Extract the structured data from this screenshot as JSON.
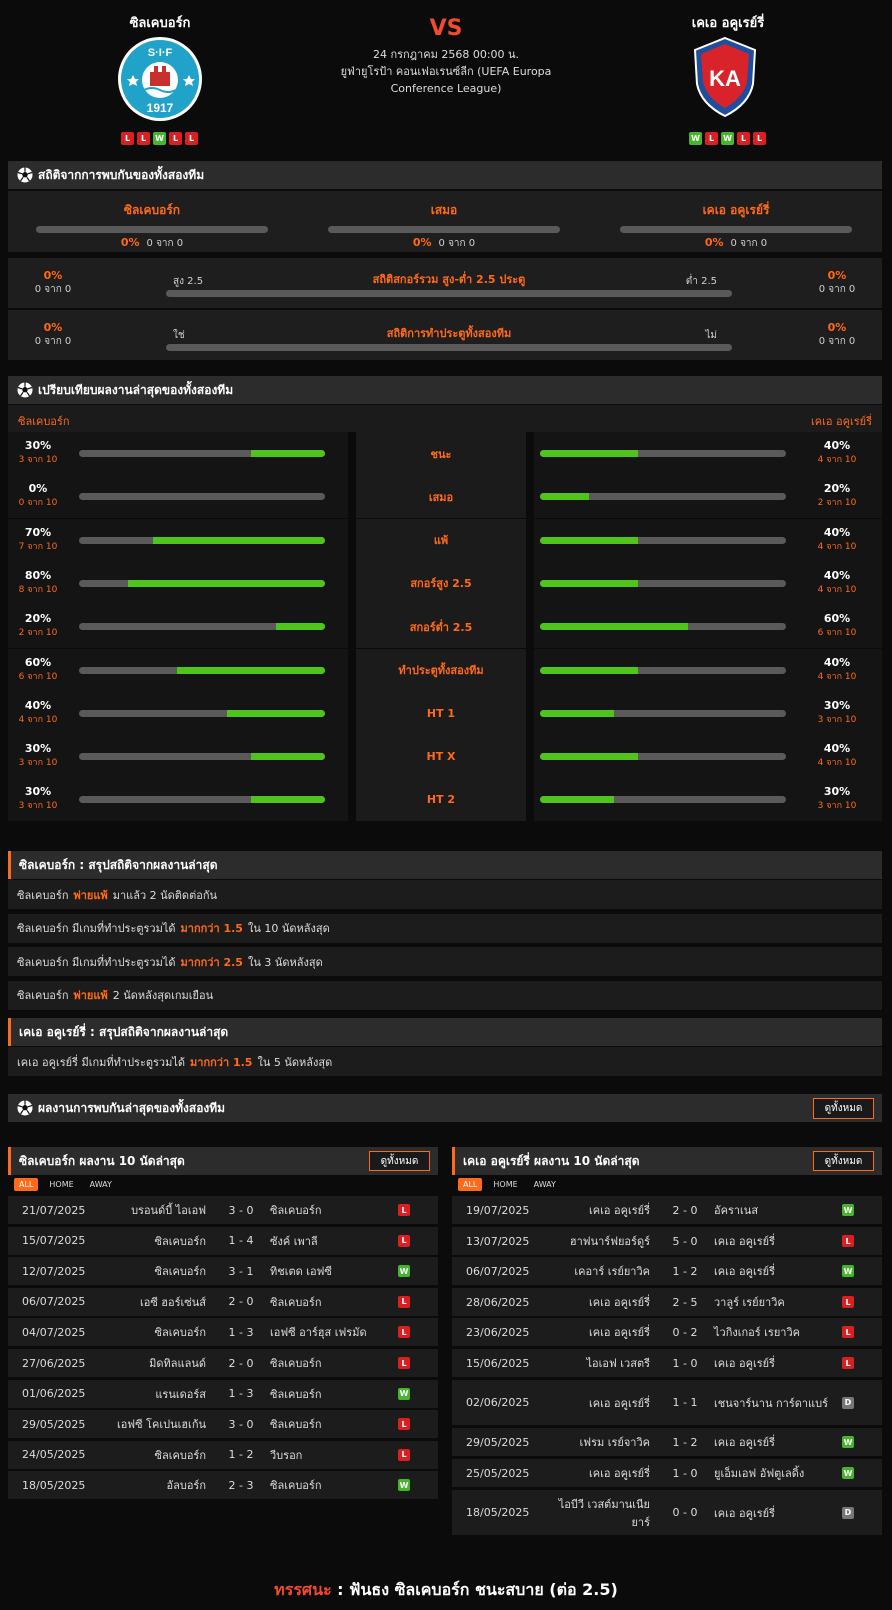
{
  "header": {
    "home": "ซิลเคบอร์ก",
    "away": "เคเอ อคูเรย์รี่",
    "vs": "VS",
    "date": "24 กรกฎาคม 2568 00:00 น.",
    "competition": "ยูฟ่ายูโรป้า คอนเฟอเรนซ์ลีก (UEFA Europa Conference League)",
    "home_form": [
      "L",
      "L",
      "W",
      "L",
      "L"
    ],
    "away_form": [
      "W",
      "L",
      "W",
      "L",
      "L"
    ],
    "home_logo_text": "S·I·F 1917",
    "away_logo_text": "KA"
  },
  "h2h": {
    "title": "สถิติจากการพบกันของทั้งสองทีม",
    "cols": [
      {
        "label": "ซิลเคบอร์ก",
        "pct": "0%",
        "of": "0 จาก 0"
      },
      {
        "label": "เสมอ",
        "pct": "0%",
        "of": "0 จาก 0"
      },
      {
        "label": "เคเอ อคูเรย์รี่",
        "pct": "0%",
        "of": "0 จาก 0"
      }
    ],
    "ou": {
      "title": "สถิติสกอร์รวม สูง-ต่ำ 2.5 ประตู",
      "left_lbl": "สูง 2.5",
      "right_lbl": "ต่ำ 2.5",
      "lp": "0%",
      "lo": "0 จาก 0",
      "rp": "0%",
      "ro": "0 จาก 0"
    },
    "btts": {
      "title": "สถิติการทำประตูทั้งสองทีม",
      "left_lbl": "ใช่",
      "right_lbl": "ไม่",
      "lp": "0%",
      "lo": "0 จาก 0",
      "rp": "0%",
      "ro": "0 จาก 0"
    }
  },
  "compare": {
    "title": "เปรียบเทียบผลงานล่าสุดของทั้งสองทีม",
    "home": "ซิลเคบอร์ก",
    "away": "เคเอ อคูเรย์รี่",
    "rows": [
      {
        "label": "ชนะ",
        "hp": "30%",
        "ho": "3 จาก 10",
        "hv": 0.3,
        "ap": "40%",
        "ao": "4 จาก 10",
        "av": 0.4
      },
      {
        "label": "เสมอ",
        "hp": "0%",
        "ho": "0 จาก 10",
        "hv": 0,
        "ap": "20%",
        "ao": "2 จาก 10",
        "av": 0.2
      },
      {
        "label": "แพ้",
        "hp": "70%",
        "ho": "7 จาก 10",
        "hv": 0.7,
        "ap": "40%",
        "ao": "4 จาก 10",
        "av": 0.4
      },
      {
        "label": "สกอร์สูง 2.5",
        "hp": "80%",
        "ho": "8 จาก 10",
        "hv": 0.8,
        "ap": "40%",
        "ao": "4 จาก 10",
        "av": 0.4
      },
      {
        "label": "สกอร์ต่ำ 2.5",
        "hp": "20%",
        "ho": "2 จาก 10",
        "hv": 0.2,
        "ap": "60%",
        "ao": "6 จาก 10",
        "av": 0.6
      },
      {
        "label": "ทำประตูทั้งสองทีม",
        "hp": "60%",
        "ho": "6 จาก 10",
        "hv": 0.6,
        "ap": "40%",
        "ao": "4 จาก 10",
        "av": 0.4
      },
      {
        "label": "HT 1",
        "hp": "40%",
        "ho": "4 จาก 10",
        "hv": 0.4,
        "ap": "30%",
        "ao": "3 จาก 10",
        "av": 0.3
      },
      {
        "label": "HT X",
        "hp": "30%",
        "ho": "3 จาก 10",
        "hv": 0.3,
        "ap": "40%",
        "ao": "4 จาก 10",
        "av": 0.4
      },
      {
        "label": "HT 2",
        "hp": "30%",
        "ho": "3 จาก 10",
        "hv": 0.3,
        "ap": "30%",
        "ao": "3 จาก 10",
        "av": 0.3
      }
    ]
  },
  "home_summary": {
    "title": "ซิลเคบอร์ก : สรุปสถิติจากผลงานล่าสุด",
    "rows": [
      [
        "ซิลเคบอร์ก",
        "พ่ายแพ้",
        "มาแล้ว 2 นัดติดต่อกัน"
      ],
      [
        "ซิลเคบอร์ก มีเกมที่ทำประตูรวมได้",
        "มากกว่า 1.5",
        "ใน 10 นัดหลังสุด"
      ],
      [
        "ซิลเคบอร์ก มีเกมที่ทำประตูรวมได้",
        "มากกว่า 2.5",
        "ใน 3 นัดหลังสุด"
      ],
      [
        "ซิลเคบอร์ก",
        "พ่ายแพ้",
        "2 นัดหลังสุดเกมเยือน"
      ]
    ]
  },
  "away_summary": {
    "title": "เคเอ อคูเรย์รี่ : สรุปสถิติจากผลงานล่าสุด",
    "rows": [
      [
        "เคเอ อคูเรย์รี่ มีเกมที่ทำประตูรวมได้",
        "มากกว่า 1.5",
        "ใน 5 นัดหลังสุด"
      ]
    ]
  },
  "recent": {
    "title": "ผลงานการพบกันล่าสุดของทั้งสองทีม",
    "view_all": "ดูทั้งหมด"
  },
  "home_panel": {
    "title": "ซิลเคบอร์ก ผลงาน 10 นัดล่าสุด",
    "view_all": "ดูทั้งหมด",
    "tabs": [
      "ALL",
      "HOME",
      "AWAY"
    ],
    "matches": [
      [
        "21/07/2025",
        "บรอนด์บี้ ไอเอฟ",
        "3 - 0",
        "ซิลเคบอร์ก",
        "L"
      ],
      [
        "15/07/2025",
        "ซิลเคบอร์ก",
        "1 - 4",
        "ซังค์ เพาลี",
        "L"
      ],
      [
        "12/07/2025",
        "ซิลเคบอร์ก",
        "3 - 1",
        "ทิชเตด เอฟซี",
        "W"
      ],
      [
        "06/07/2025",
        "เอซี ฮอร์เซ่นส์",
        "2 - 0",
        "ซิลเคบอร์ก",
        "L"
      ],
      [
        "04/07/2025",
        "ซิลเคบอร์ก",
        "1 - 3",
        "เอฟซี อาร์ฮุส เฟรมัด",
        "L"
      ],
      [
        "27/06/2025",
        "มิดทิลแลนด์",
        "2 - 0",
        "ซิลเคบอร์ก",
        "L"
      ],
      [
        "01/06/2025",
        "แรนเดอร์ส",
        "1 - 3",
        "ซิลเคบอร์ก",
        "W"
      ],
      [
        "29/05/2025",
        "เอฟซี โคเปนเฮเก้น",
        "3 - 0",
        "ซิลเคบอร์ก",
        "L"
      ],
      [
        "24/05/2025",
        "ซิลเคบอร์ก",
        "1 - 2",
        "วีบรอก",
        "L"
      ],
      [
        "18/05/2025",
        "อัลบอร์ก",
        "2 - 3",
        "ซิลเคบอร์ก",
        "W"
      ]
    ]
  },
  "away_panel": {
    "title": "เคเอ อคูเรย์รี่ ผลงาน 10 นัดล่าสุด",
    "view_all": "ดูทั้งหมด",
    "tabs": [
      "ALL",
      "HOME",
      "AWAY"
    ],
    "matches": [
      [
        "19/07/2025",
        "เคเอ อคูเรย์รี่",
        "2 - 0",
        "อัคราเนส",
        "W"
      ],
      [
        "13/07/2025",
        "ฮาฟนาร์ฟยอร์ดูร์",
        "5 - 0",
        "เคเอ อคูเรย์รี่",
        "L"
      ],
      [
        "06/07/2025",
        "เคอาร์ เรย์ยาวิค",
        "1 - 2",
        "เคเอ อคูเรย์รี่",
        "W"
      ],
      [
        "28/06/2025",
        "เคเอ อคูเรย์รี่",
        "2 - 5",
        "วาลูร์ เรย์ยาวิค",
        "L"
      ],
      [
        "23/06/2025",
        "เคเอ อคูเรย์รี่",
        "0 - 2",
        "ไวกิงเกอร์ เรยาวิค",
        "L"
      ],
      [
        "15/06/2025",
        "ไอเอฟ เวสตรี",
        "1 - 0",
        "เคเอ อคูเรย์รี่",
        "L"
      ],
      [
        "02/06/2025",
        "เคเอ อคูเรย์รี่",
        "1 - 1",
        "เชนจาร์นาน การ์ดาแบร์",
        "D"
      ],
      [
        "29/05/2025",
        "เฟรม เรย์จาวิค",
        "1 - 2",
        "เคเอ อคูเรย์รี่",
        "W"
      ],
      [
        "25/05/2025",
        "เคเอ อคูเรย์รี่",
        "1 - 0",
        "ยูเอ็มเอฟ อัฟตูเลดิ้ง",
        "W"
      ],
      [
        "18/05/2025",
        "ไอบีวี เวสต์มานเนียยาร์",
        "0 - 0",
        "เคเอ อคูเรย์รี่",
        "D"
      ]
    ]
  },
  "verdict": {
    "label": "ทรรศนะ",
    "sep": ":",
    "text": "ฟันธง ซิลเคบอร์ก ชนะสบาย (ต่อ 2.5)"
  },
  "colors": {
    "accent": "#ff6a1a",
    "win": "#45b52a",
    "loss": "#d91f1f",
    "draw": "#777777",
    "bar_fill": "#4fc41a",
    "vs": "#f04b2c"
  }
}
